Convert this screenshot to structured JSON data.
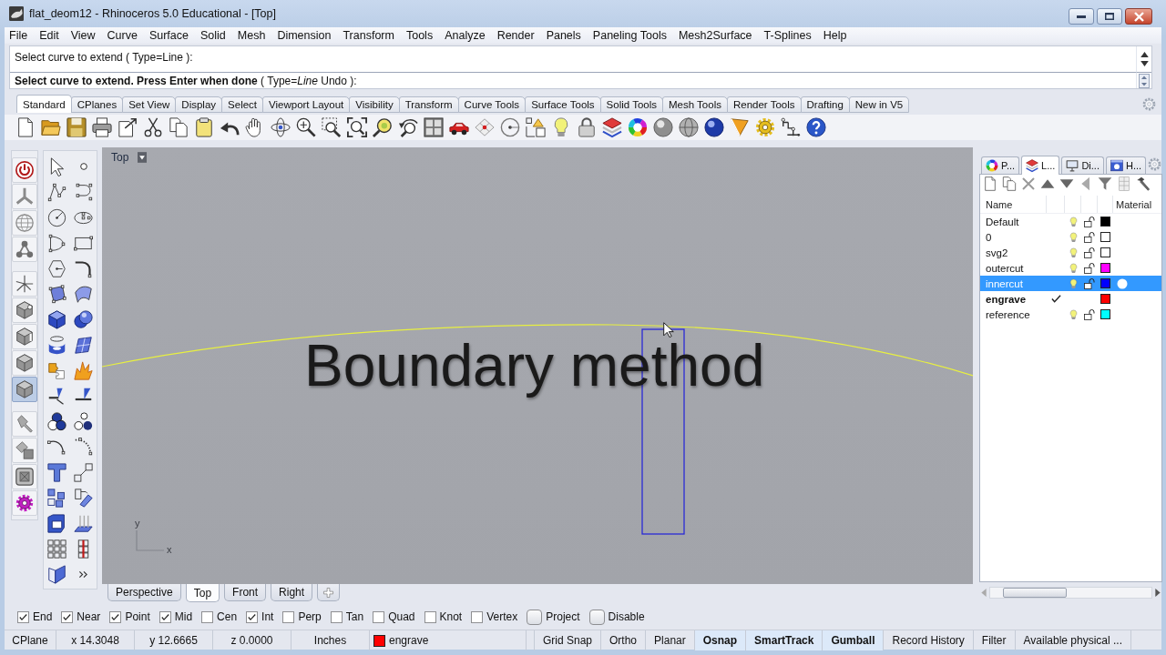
{
  "window": {
    "title": "flat_deom12 - Rhinoceros 5.0 Educational - [Top]"
  },
  "menu": [
    "File",
    "Edit",
    "View",
    "Curve",
    "Surface",
    "Solid",
    "Mesh",
    "Dimension",
    "Transform",
    "Tools",
    "Analyze",
    "Render",
    "Panels",
    "Paneling Tools",
    "Mesh2Surface",
    "T-Splines",
    "Help"
  ],
  "command": {
    "history": [
      "Select curve to extend ( Type=Line ):"
    ],
    "prompt": "**Select curve to extend. Press Enter when done** ( Type=*Line* Undo ):"
  },
  "toolbar_tabs": [
    {
      "label": "Standard",
      "selected": true
    },
    {
      "label": "CPlanes",
      "selected": false
    },
    {
      "label": "Set View",
      "selected": false
    },
    {
      "label": "Display",
      "selected": false
    },
    {
      "label": "Select",
      "selected": false
    },
    {
      "label": "Viewport Layout",
      "selected": false
    },
    {
      "label": "Visibility",
      "selected": false
    },
    {
      "label": "Transform",
      "selected": false
    },
    {
      "label": "Curve Tools",
      "selected": false
    },
    {
      "label": "Surface Tools",
      "selected": false
    },
    {
      "label": "Solid Tools",
      "selected": false
    },
    {
      "label": "Mesh Tools",
      "selected": false
    },
    {
      "label": "Render Tools",
      "selected": false
    },
    {
      "label": "Drafting",
      "selected": false
    },
    {
      "label": "New in V5",
      "selected": false
    }
  ],
  "side_toolbar": [
    {
      "selected": false
    },
    {
      "selected": false
    },
    {
      "selected": false
    },
    {
      "selected": false
    },
    {
      "selected": false
    },
    {
      "selected": false
    },
    {
      "selected": false
    },
    {
      "selected": false
    },
    {
      "selected": true
    },
    {
      "selected": false
    },
    {
      "selected": false
    },
    {
      "selected": false
    },
    {
      "selected": false
    }
  ],
  "viewport": {
    "title": "Top",
    "caption": "Boundary method",
    "axis_labels": [
      "y",
      "x"
    ]
  },
  "viewport_tabs": [
    {
      "label": "Perspective",
      "selected": false
    },
    {
      "label": "Top",
      "selected": true
    },
    {
      "label": "Front",
      "selected": false
    },
    {
      "label": "Right",
      "selected": false
    }
  ],
  "panel_tabs": [
    {
      "label": "P...",
      "selected": false
    },
    {
      "label": "L...",
      "selected": true
    },
    {
      "label": "Di...",
      "selected": false
    },
    {
      "label": "H...",
      "selected": false
    }
  ],
  "layers": {
    "columns": [
      "Name",
      "Material"
    ],
    "rows": [
      {
        "name": "Default",
        "selected": false,
        "current": false,
        "color": "#000000"
      },
      {
        "name": "0",
        "selected": false,
        "current": false,
        "color": "#ffffff"
      },
      {
        "name": "svg2",
        "selected": false,
        "current": false,
        "color": "#ffffff"
      },
      {
        "name": "outercut",
        "selected": false,
        "current": false,
        "color": "#ff00ff"
      },
      {
        "name": "innercut",
        "selected": true,
        "current": false,
        "color": "#0000ff"
      },
      {
        "name": "engrave",
        "selected": false,
        "current": true,
        "color": "#ff0000"
      },
      {
        "name": "reference",
        "selected": false,
        "current": false,
        "color": "#00ffff"
      }
    ]
  },
  "osnaps": [
    {
      "label": "End",
      "checked": true,
      "kind": "check"
    },
    {
      "label": "Near",
      "checked": true,
      "kind": "check"
    },
    {
      "label": "Point",
      "checked": true,
      "kind": "check"
    },
    {
      "label": "Mid",
      "checked": true,
      "kind": "check"
    },
    {
      "label": "Cen",
      "checked": false,
      "kind": "check"
    },
    {
      "label": "Int",
      "checked": true,
      "kind": "check"
    },
    {
      "label": "Perp",
      "checked": false,
      "kind": "check"
    },
    {
      "label": "Tan",
      "checked": false,
      "kind": "check"
    },
    {
      "label": "Quad",
      "checked": false,
      "kind": "check"
    },
    {
      "label": "Knot",
      "checked": false,
      "kind": "check"
    },
    {
      "label": "Vertex",
      "checked": false,
      "kind": "check"
    },
    {
      "label": "Project",
      "checked": false,
      "kind": "toggle"
    },
    {
      "label": "Disable",
      "checked": false,
      "kind": "toggle"
    }
  ],
  "status_bar": {
    "cplane": "CPlane",
    "x": "x 14.3048",
    "y": "y 12.6665",
    "z": "z 0.0000",
    "units": "Inches",
    "layer": {
      "name": "engrave",
      "color": "#ff0000"
    },
    "panes": [
      {
        "label": "Grid Snap",
        "on": false
      },
      {
        "label": "Ortho",
        "on": false
      },
      {
        "label": "Planar",
        "on": false
      },
      {
        "label": "Osnap",
        "on": true
      },
      {
        "label": "SmartTrack",
        "on": true
      },
      {
        "label": "Gumball",
        "on": true
      },
      {
        "label": "Record History",
        "on": false
      },
      {
        "label": "Filter",
        "on": false
      }
    ],
    "memory": "Available physical ..."
  }
}
